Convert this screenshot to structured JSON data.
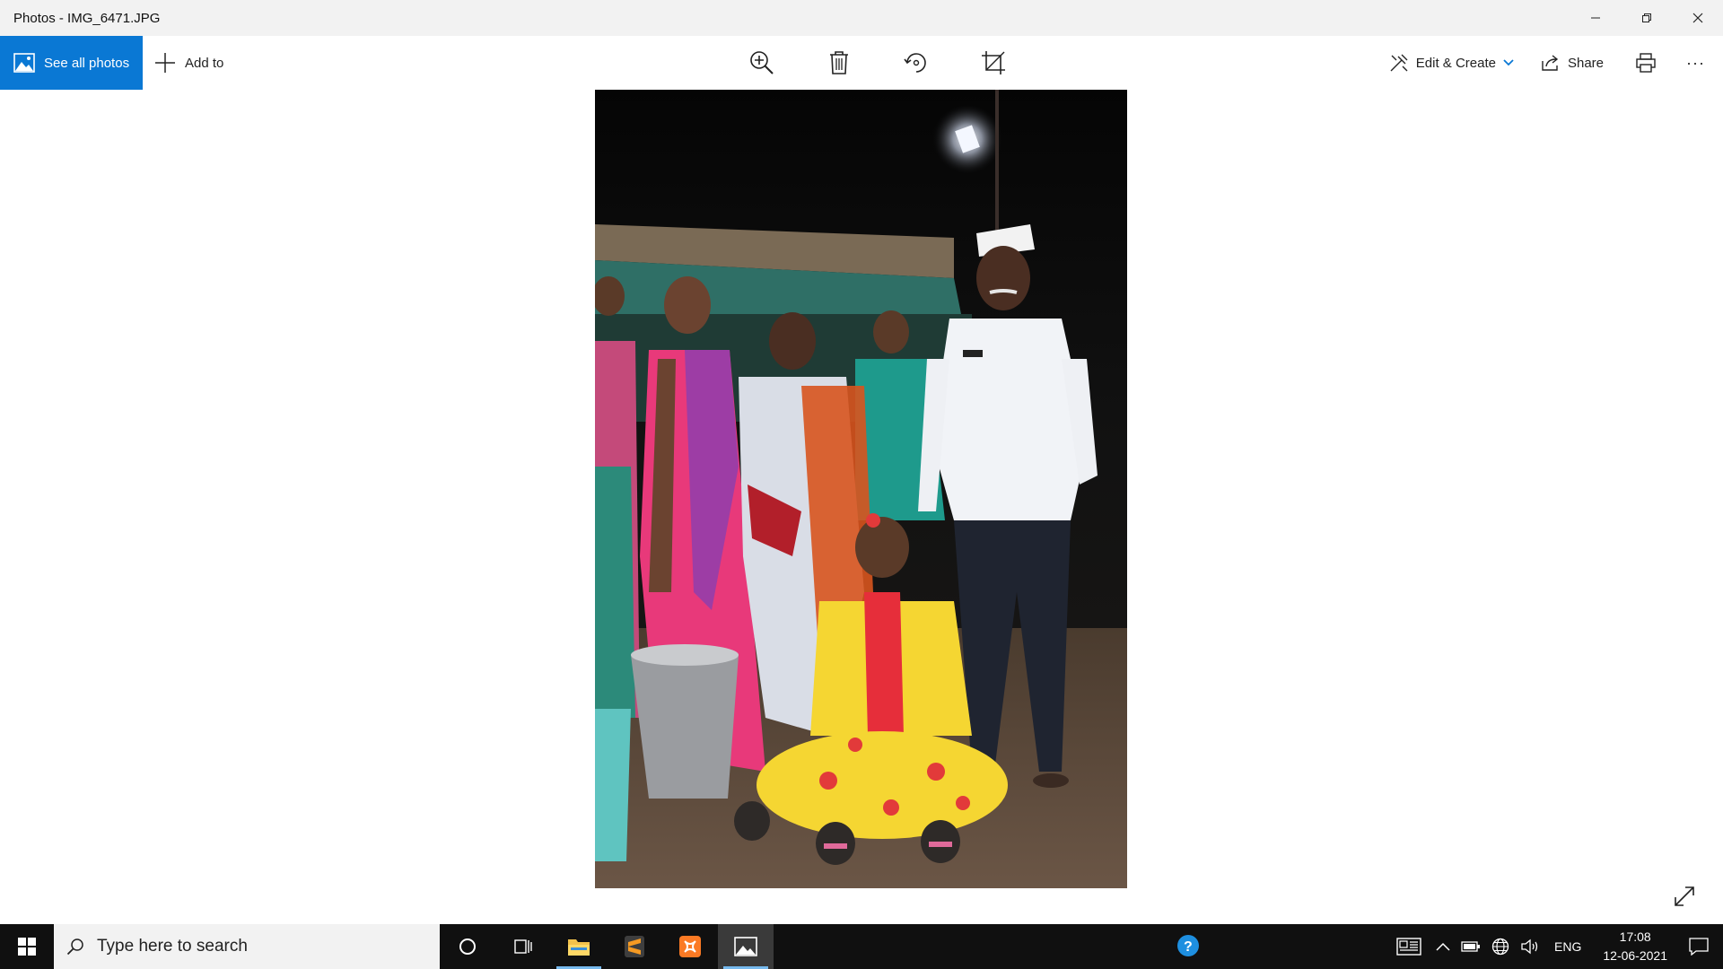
{
  "window": {
    "title": "Photos - IMG_6471.JPG",
    "controls": [
      "minimize-icon",
      "restore-icon",
      "close-icon"
    ]
  },
  "toolbar": {
    "see_all_label": "See all photos",
    "add_to_label": "Add to",
    "center_tools": [
      "zoom-icon",
      "delete-icon",
      "rotate-icon",
      "crop-icon"
    ],
    "edit_create_label": "Edit & Create",
    "share_label": "Share",
    "more_label": "···",
    "accent_color": "#0a78d4"
  },
  "taskbar": {
    "search_placeholder": "Type here to search",
    "apps": [
      "cortana-icon",
      "task-view-icon",
      "file-explorer-icon",
      "sublime-text-icon",
      "xampp-icon",
      "photos-icon"
    ],
    "tray_language": "ENG",
    "clock_time": "17:08",
    "clock_date": "12-06-2021"
  }
}
